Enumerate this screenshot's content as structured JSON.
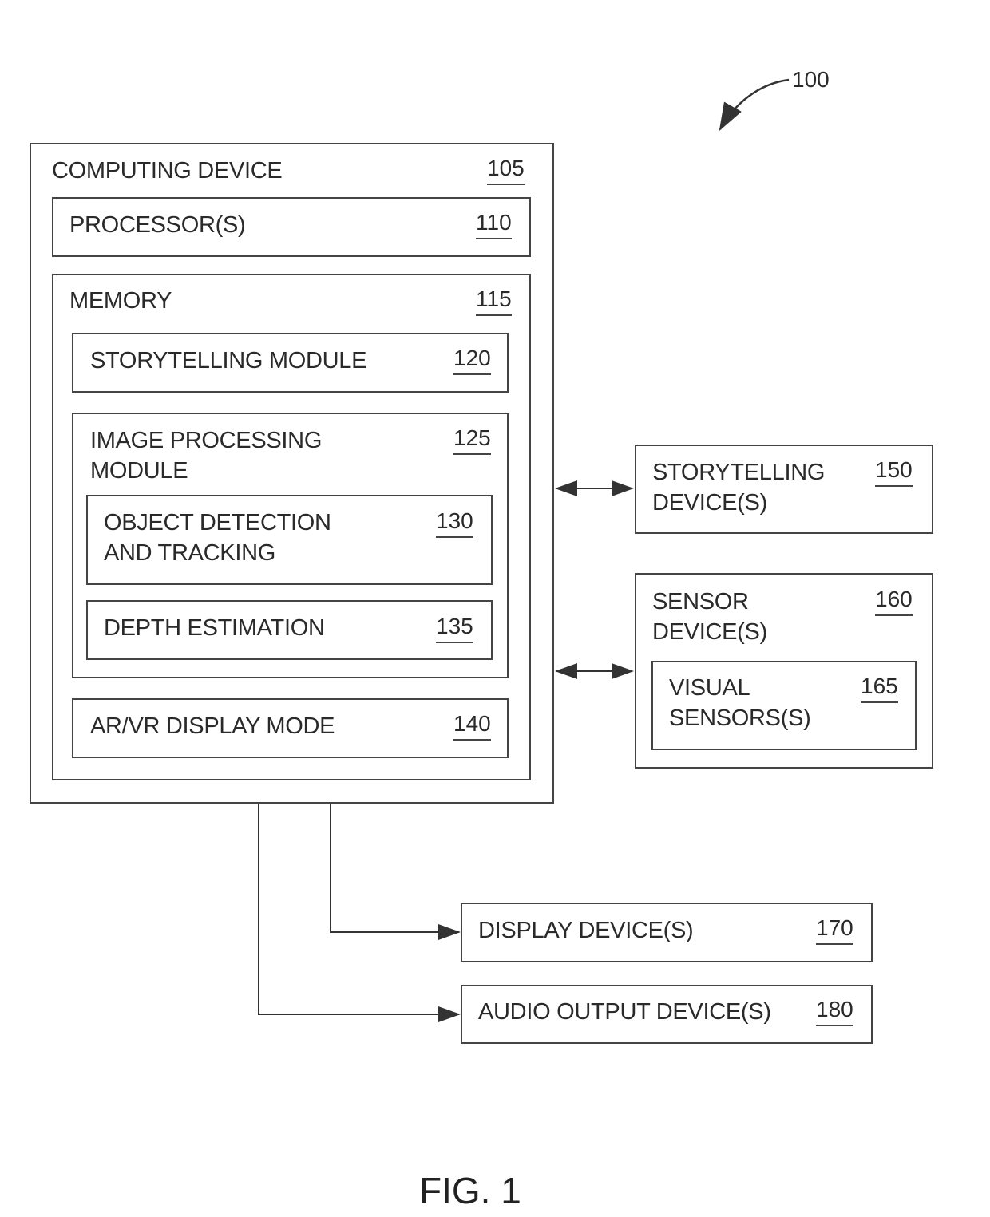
{
  "figure_ref": "100",
  "caption": "FIG. 1",
  "computing_device": {
    "label": "COMPUTING DEVICE",
    "ref": "105"
  },
  "processor": {
    "label": "PROCESSOR(S)",
    "ref": "110"
  },
  "memory": {
    "label": "MEMORY",
    "ref": "115"
  },
  "storytelling_module": {
    "label": "STORYTELLING MODULE",
    "ref": "120"
  },
  "image_processing_module": {
    "label": "IMAGE PROCESSING\nMODULE",
    "ref": "125"
  },
  "object_detection": {
    "label": "OBJECT DETECTION\nAND TRACKING",
    "ref": "130"
  },
  "depth_estimation": {
    "label": "DEPTH ESTIMATION",
    "ref": "135"
  },
  "arvr_display_mode": {
    "label": "AR/VR DISPLAY MODE",
    "ref": "140"
  },
  "storytelling_devices": {
    "label": "STORYTELLING\nDEVICE(S)",
    "ref": "150"
  },
  "sensor_devices": {
    "label": "SENSOR\nDEVICE(S)",
    "ref": "160"
  },
  "visual_sensors": {
    "label": "VISUAL\nSENSORS(S)",
    "ref": "165"
  },
  "display_devices": {
    "label": "DISPLAY DEVICE(S)",
    "ref": "170"
  },
  "audio_output_devices": {
    "label": "AUDIO OUTPUT DEVICE(S)",
    "ref": "180"
  }
}
